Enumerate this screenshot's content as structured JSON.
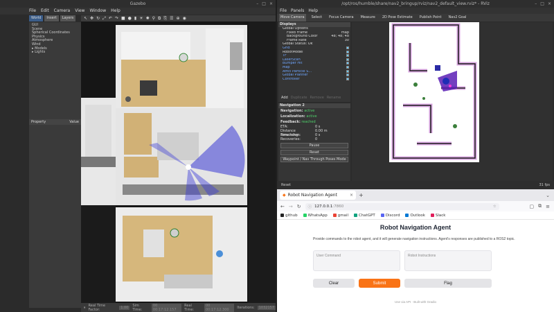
{
  "gazebo": {
    "title": "Gazebo",
    "window_controls": [
      "–",
      "□",
      "×"
    ],
    "menu": [
      "File",
      "Edit",
      "Camera",
      "View",
      "Window",
      "Help"
    ],
    "tabs": [
      "World",
      "Insert",
      "Layers"
    ],
    "tree": [
      "GUI",
      "Scene",
      "Spherical Coordinates",
      "Physics",
      "Atmosphere",
      "Wind",
      "▸ Models",
      "▸ Lights"
    ],
    "property_header": [
      "Property",
      "Value"
    ],
    "status": {
      "rtf_label": "Real Time Factor:",
      "rtf_value": "1.00",
      "sim_label": "Sim Time:",
      "sim_value": "00 00:17:12.157",
      "real_label": "Real Time:",
      "real_value": "00 00:17:12.300",
      "iter_label": "Iterations:",
      "iter_value": "1032157"
    }
  },
  "rviz": {
    "title": "/opt/ros/humble/share/nav2_bringup/rviz/nav2_default_view.rviz* - RViz",
    "window_controls": [
      "–",
      "□",
      "×"
    ],
    "menu": [
      "File",
      "Panels",
      "Help"
    ],
    "tools": [
      "Move Camera",
      "Select",
      "Focus Camera",
      "Measure",
      "2D Pose Estimate",
      "Publish Point",
      "Nav2 Goal"
    ],
    "displays_title": "Displays",
    "displays": [
      {
        "name": "Global Options",
        "value": "",
        "level": 0,
        "color": "",
        "check": ""
      },
      {
        "name": "Fixed Frame",
        "value": "map",
        "level": 1,
        "color": "",
        "check": ""
      },
      {
        "name": "Background Color",
        "value": "48; 48; 48",
        "level": 1,
        "color": "",
        "check": ""
      },
      {
        "name": "Frame Rate",
        "value": "30",
        "level": 1,
        "color": "",
        "check": ""
      },
      {
        "name": "Global Status: Ok",
        "value": "",
        "level": 0,
        "color": "",
        "check": ""
      },
      {
        "name": "Grid",
        "value": "",
        "level": 0,
        "color": "blue",
        "check": "on"
      },
      {
        "name": "RobotModel",
        "value": "",
        "level": 0,
        "color": "",
        "check": "on"
      },
      {
        "name": "TF",
        "value": "",
        "level": 0,
        "color": "blue",
        "check": "on"
      },
      {
        "name": "LaserScan",
        "value": "",
        "level": 0,
        "color": "blue",
        "check": "on"
      },
      {
        "name": "Bumper Hit",
        "value": "",
        "level": 0,
        "color": "blue",
        "check": "on"
      },
      {
        "name": "Map",
        "value": "",
        "level": 0,
        "color": "blue",
        "check": "on"
      },
      {
        "name": "Amcl Particle S…",
        "value": "",
        "level": 0,
        "color": "blue",
        "check": "on"
      },
      {
        "name": "Global Planner",
        "value": "",
        "level": 0,
        "color": "blue",
        "check": "on"
      },
      {
        "name": "Controller",
        "value": "",
        "level": 0,
        "color": "blue",
        "check": "on"
      }
    ],
    "display_buttons": [
      "Add",
      "Duplicate",
      "Remove",
      "Rename"
    ],
    "nav2": {
      "title": "Navigation 2",
      "navigation_label": "Navigation:",
      "navigation_value": "active",
      "localization_label": "Localization:",
      "localization_value": "active",
      "feedback_label": "Feedback:",
      "feedback_value": "reached",
      "eta_label": "ETA:",
      "eta_value": "0 s",
      "distance_label": "Distance remaining:",
      "distance_value": "0.00 m",
      "time_label": "Time taken:",
      "time_value": "0 s",
      "recoveries_label": "Recoveries:",
      "recoveries_value": "0",
      "pause_button": "Pause",
      "reset_button": "Reset",
      "waypoint_button": "Waypoint / Nav Through Poses Mode"
    },
    "footer_reset": "Reset",
    "fps": "31 fps"
  },
  "browser": {
    "tab_title": "Robot Navigation Agent",
    "url_host": "127.0.0.1",
    "url_port": ":7860",
    "bookmarks": [
      {
        "label": "github",
        "color": "#222222"
      },
      {
        "label": "WhatsApp",
        "color": "#25d366"
      },
      {
        "label": "gmail",
        "color": "#ea4335"
      },
      {
        "label": "ChatGPT",
        "color": "#10a37f"
      },
      {
        "label": "Discord",
        "color": "#5865f2"
      },
      {
        "label": "Outlook",
        "color": "#0078d4"
      },
      {
        "label": "Slack",
        "color": "#e01e5a"
      }
    ],
    "page": {
      "title": "Robot Navigation Agent",
      "description": "Provide commands to the robot agent, and it will generate navigation instructions. Agent's responses are published to a ROS2 topic.",
      "user_command_label": "User Command",
      "robot_instructions_label": "Robot Instructions",
      "clear_button": "Clear",
      "submit_button": "Submit",
      "flag_button": "Flag",
      "footer": "Use via API  ·  Built with Gradio"
    },
    "colors": {
      "submit": "#f97316",
      "clear": "#e4e4e7",
      "flag": "#e4e4e7"
    }
  }
}
